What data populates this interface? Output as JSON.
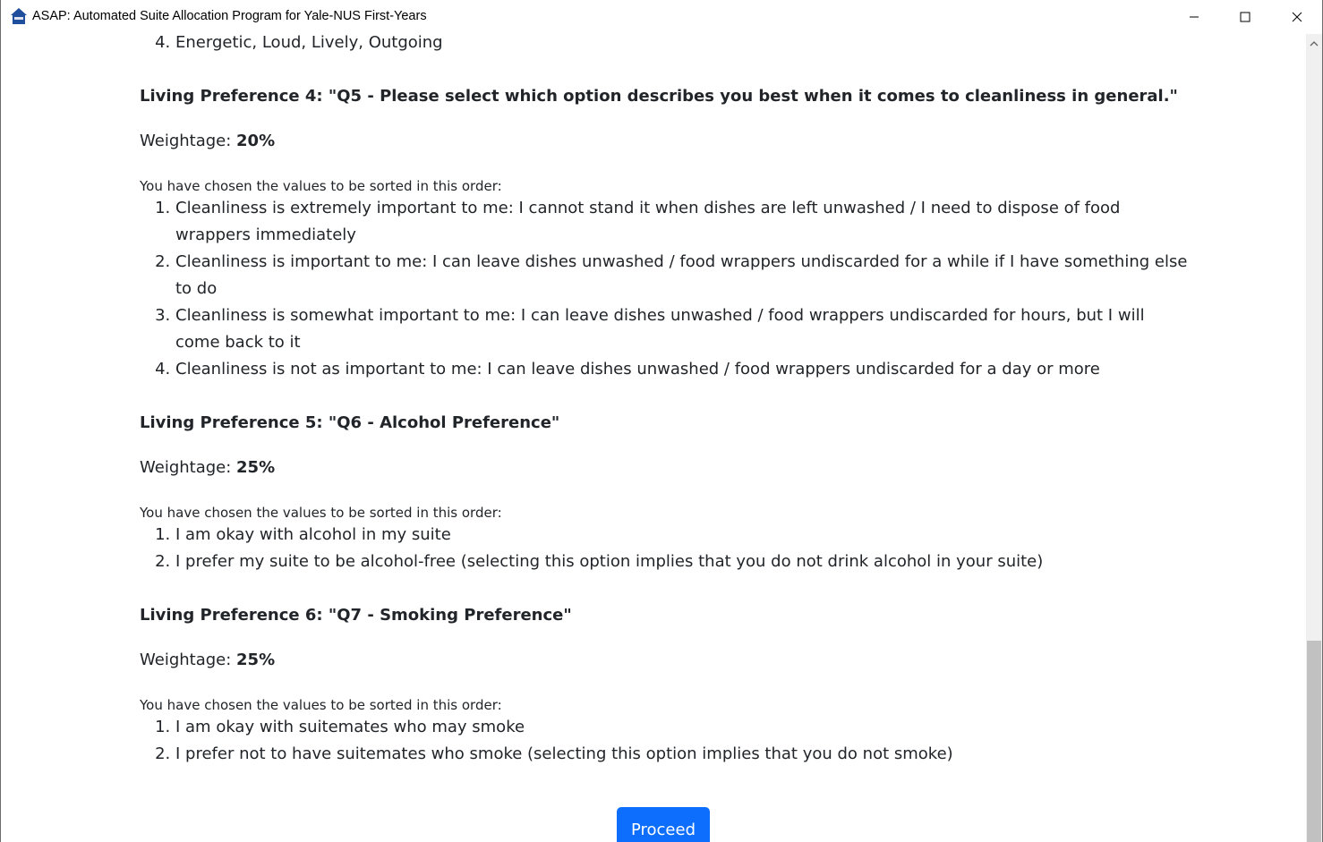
{
  "window": {
    "title": "ASAP: Automated Suite Allocation Program for Yale-NUS First-Years",
    "icon": "house-icon",
    "buttons": [
      "minimize-icon",
      "maximize-icon",
      "close-icon"
    ]
  },
  "top_item": {
    "number": "4.",
    "text": "Energetic, Loud, Lively, Outgoing"
  },
  "preferences": [
    {
      "heading": "Living Preference 4: \"Q5 - Please select which option describes you best when it comes to cleanliness in general.\"",
      "weight_label": "Weightage: ",
      "weight_value": "20%",
      "note": "You have chosen the values to be sorted in this order:",
      "items": [
        "Cleanliness is extremely important to me: I cannot stand it when dishes are left unwashed / I need to dispose of food wrappers immediately",
        "Cleanliness is important to me: I can leave dishes unwashed / food wrappers undiscarded for a while if I have something else to do",
        "Cleanliness is somewhat important to me: I can leave dishes unwashed / food wrappers undiscarded for hours, but I will come back to it",
        "Cleanliness is not as important to me: I can leave dishes unwashed / food wrappers undiscarded for a day or more"
      ]
    },
    {
      "heading": "Living Preference 5: \"Q6 - Alcohol Preference\"",
      "weight_label": "Weightage: ",
      "weight_value": "25%",
      "note": "You have chosen the values to be sorted in this order:",
      "items": [
        "I am okay with alcohol in my suite",
        "I prefer my suite to be alcohol-free (selecting this option implies that you do not drink alcohol in your suite)"
      ]
    },
    {
      "heading": "Living Preference 6: \"Q7 - Smoking Preference\"",
      "weight_label": "Weightage: ",
      "weight_value": "25%",
      "note": "You have chosen the values to be sorted in this order:",
      "items": [
        "I am okay with suitemates who may smoke",
        "I prefer not to have suitemates who smoke (selecting this option implies that you do not smoke)"
      ]
    }
  ],
  "proceed_label": "Proceed",
  "colors": {
    "primary": "#0d6efd",
    "text": "#212529",
    "scrollbar_thumb": "#c1c1c1"
  }
}
